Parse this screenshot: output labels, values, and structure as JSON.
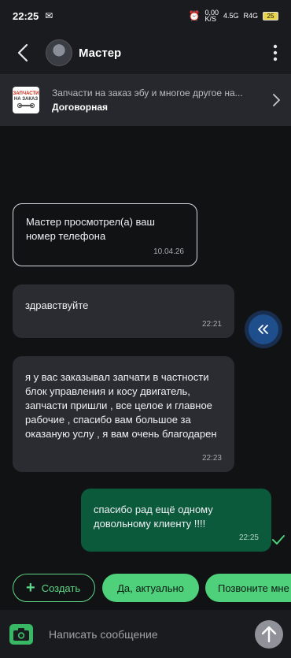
{
  "status_bar": {
    "time": "22:25",
    "net_speed": "0,00",
    "net_unit": "K/S",
    "network_1": "4.5G",
    "network_2": "R4G",
    "battery": "25"
  },
  "header": {
    "contact_name": "Мастер",
    "icons": [
      "back-arrow-icon",
      "avatar",
      "more-vertical-icon"
    ]
  },
  "listing": {
    "title": "Запчасти на заказ эбу и многое другое на...",
    "price": "Договорная",
    "thumb_line1": "ЗАПЧАСТИ",
    "thumb_line2": "НА ЗАКАЗ"
  },
  "messages": [
    {
      "type": "system",
      "text": "Мастер просмотрел(а) ваш номер телефона",
      "time": "10.04.26"
    },
    {
      "type": "incoming",
      "text": "здравствуйте",
      "time": "22:21"
    },
    {
      "type": "incoming",
      "text": "я у вас заказывал запчати в частности блок управления и косу двигатель,  запчасти пришли , все целое и главное рабочие , спасибо вам большое за оказаную услу , я вам очень благодарен",
      "time": "22:23"
    },
    {
      "type": "outgoing",
      "text": "спасибо рад ещё одному довольному клиенту !!!!",
      "time": "22:25",
      "status": "read"
    }
  ],
  "quick_replies": {
    "create": "Создать",
    "yes": "Да, актуально",
    "call": "Позвоните мне"
  },
  "composer": {
    "placeholder": "Написать сообщение"
  },
  "colors": {
    "background": "#111214",
    "incoming_bubble": "#2a2c32",
    "outgoing_bubble": "#0c5a3c",
    "accent_green": "#4fd17c",
    "scroll_button": "#1e4f8c"
  }
}
